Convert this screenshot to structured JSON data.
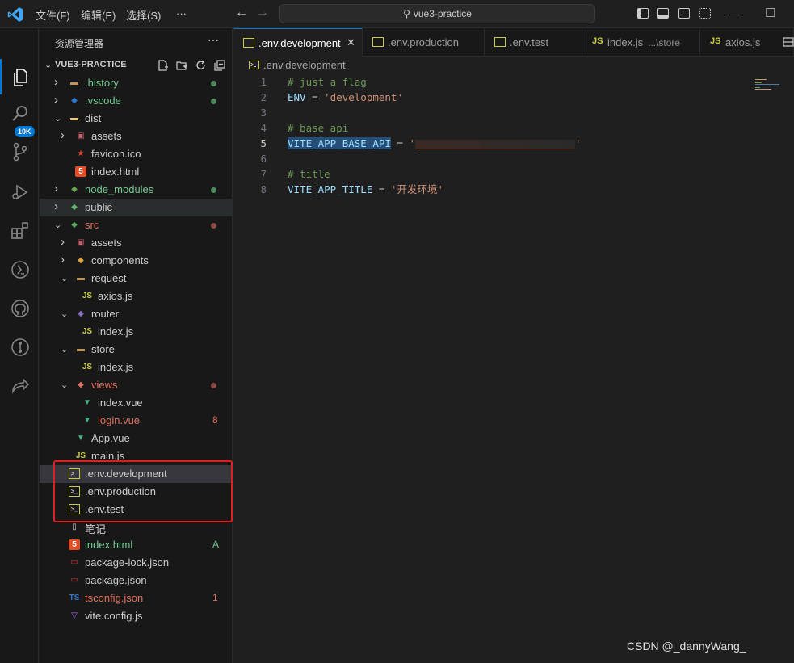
{
  "titlebar": {
    "menus": [
      "文件(F)",
      "编辑(E)",
      "选择(S)",
      "···"
    ],
    "search_text": "vue3-practice",
    "back_arrow": "←",
    "forward_arrow": "→"
  },
  "activity": {
    "icons": [
      "explorer-icon",
      "search-icon",
      "source-control-icon",
      "run-debug-icon",
      "extensions-icon",
      "remote-explorer-icon",
      "github-icon",
      "git-graph-icon",
      "live-share-icon"
    ],
    "source_control_badge": "10K"
  },
  "sidebar": {
    "title": "资源管理器",
    "more": "···",
    "project": "VUE3-PRACTICE",
    "items": [
      {
        "label": ".history",
        "kind": "folder",
        "color": "#73c991",
        "open": false,
        "depth": 0,
        "dot": "#4f8a5e"
      },
      {
        "label": ".vscode",
        "kind": "folder-vscode",
        "color": "#73c991",
        "open": false,
        "depth": 0,
        "dot": "#4f8a5e"
      },
      {
        "label": "dist",
        "kind": "folder-dist",
        "color": "#cccccc",
        "open": true,
        "depth": 0
      },
      {
        "label": "assets",
        "kind": "folder-assets",
        "color": "#cccccc",
        "open": false,
        "depth": 1
      },
      {
        "label": "favicon.ico",
        "kind": "ico",
        "color": "#cccccc",
        "depth": 1
      },
      {
        "label": "index.html",
        "kind": "html",
        "color": "#cccccc",
        "depth": 1
      },
      {
        "label": "node_modules",
        "kind": "folder-node",
        "color": "#73c991",
        "open": false,
        "depth": 0,
        "dot": "#4f8a5e"
      },
      {
        "label": "public",
        "kind": "folder-public",
        "color": "#cccccc",
        "open": false,
        "depth": 0,
        "hover": true
      },
      {
        "label": "src",
        "kind": "folder-src",
        "color": "#e2705e",
        "open": true,
        "depth": 0,
        "dot": "#8c4a42"
      },
      {
        "label": "assets",
        "kind": "folder-assets",
        "color": "#cccccc",
        "open": false,
        "depth": 1
      },
      {
        "label": "components",
        "kind": "folder-components",
        "color": "#cccccc",
        "open": false,
        "depth": 1
      },
      {
        "label": "request",
        "kind": "folder",
        "color": "#cccccc",
        "open": true,
        "depth": 1
      },
      {
        "label": "axios.js",
        "kind": "js",
        "color": "#cccccc",
        "depth": 2
      },
      {
        "label": "router",
        "kind": "folder-router",
        "color": "#cccccc",
        "open": true,
        "depth": 1
      },
      {
        "label": "index.js",
        "kind": "js",
        "color": "#cccccc",
        "depth": 2
      },
      {
        "label": "store",
        "kind": "folder",
        "color": "#cccccc",
        "open": true,
        "depth": 1
      },
      {
        "label": "index.js",
        "kind": "js",
        "color": "#cccccc",
        "depth": 2
      },
      {
        "label": "views",
        "kind": "folder-views",
        "color": "#e2705e",
        "open": true,
        "depth": 1,
        "dot": "#8c4a42"
      },
      {
        "label": "index.vue",
        "kind": "vue",
        "color": "#cccccc",
        "depth": 2
      },
      {
        "label": "login.vue",
        "kind": "vue",
        "color": "#e2705e",
        "depth": 2,
        "status": "8",
        "status_color": "#e2705e"
      },
      {
        "label": "App.vue",
        "kind": "vue",
        "color": "#cccccc",
        "depth": 1
      },
      {
        "label": "main.js",
        "kind": "js",
        "color": "#cccccc",
        "depth": 1
      },
      {
        "label": ".env.development",
        "kind": "env",
        "color": "#cccccc",
        "depth": 0,
        "selected": true
      },
      {
        "label": ".env.production",
        "kind": "env",
        "color": "#cccccc",
        "depth": 0
      },
      {
        "label": ".env.test",
        "kind": "env",
        "color": "#cccccc",
        "depth": 0
      },
      {
        "label": "笔记",
        "kind": "file",
        "color": "#cccccc",
        "depth": 0
      },
      {
        "label": "index.html",
        "kind": "html",
        "color": "#73c991",
        "depth": 0,
        "status": "A",
        "status_color": "#73c991"
      },
      {
        "label": "package-lock.json",
        "kind": "npm",
        "color": "#cccccc",
        "depth": 0
      },
      {
        "label": "package.json",
        "kind": "npm",
        "color": "#cccccc",
        "depth": 0
      },
      {
        "label": "tsconfig.json",
        "kind": "ts",
        "color": "#e2705e",
        "depth": 0,
        "status": "1",
        "status_color": "#e2705e"
      },
      {
        "label": "vite.config.js",
        "kind": "vite",
        "color": "#cccccc",
        "depth": 0
      }
    ]
  },
  "tabs": [
    {
      "label": ".env.development",
      "active": true,
      "kind": "env"
    },
    {
      "label": ".env.production",
      "active": false,
      "kind": "env"
    },
    {
      "label": ".env.test",
      "active": false,
      "kind": "env"
    },
    {
      "label": "index.js",
      "sub": "...\\store",
      "active": false,
      "kind": "js"
    },
    {
      "label": "axios.js",
      "active": false,
      "kind": "js"
    }
  ],
  "breadcrumb": ".env.development",
  "editor": {
    "lines": [
      {
        "n": "1",
        "type": "comment",
        "text": "# just a flag"
      },
      {
        "n": "2",
        "type": "kv",
        "key": "ENV",
        "value": "'development'"
      },
      {
        "n": "3",
        "type": "blank",
        "text": ""
      },
      {
        "n": "4",
        "type": "comment",
        "text": "# base api"
      },
      {
        "n": "5",
        "type": "kv-redacted",
        "key": "VITE_APP_BASE_API",
        "value_start": "'",
        "value_end": "'",
        "current": true
      },
      {
        "n": "6",
        "type": "blank",
        "text": ""
      },
      {
        "n": "7",
        "type": "comment",
        "text": "# title"
      },
      {
        "n": "8",
        "type": "kv",
        "key": "VITE_APP_TITLE",
        "value": "'开发环境'"
      }
    ]
  },
  "watermark": "CSDN @_dannyWang_"
}
